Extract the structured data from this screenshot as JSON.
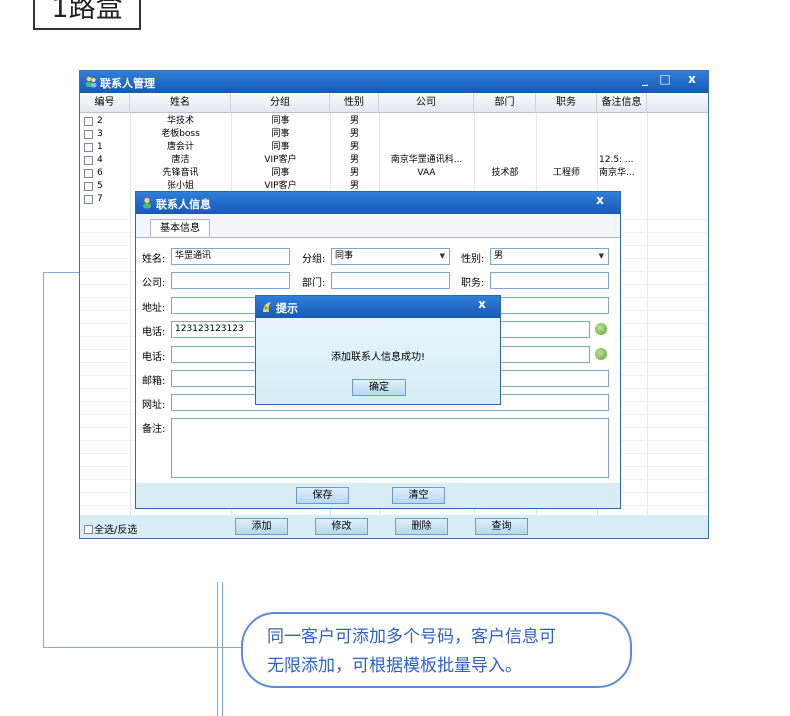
{
  "heading": {
    "text": "1路盒"
  },
  "main_window": {
    "title": "联系人管理",
    "controls": {
      "minimize": "_",
      "maximize": "□",
      "close": "x"
    },
    "columns": [
      "编号",
      "姓名",
      "分组",
      "性别",
      "公司",
      "部门",
      "职务",
      "备注信息"
    ],
    "rows": [
      {
        "id": "2",
        "name": "华技术",
        "group": "同事",
        "gender": "男",
        "company": "",
        "dept": "",
        "title": "",
        "note": ""
      },
      {
        "id": "3",
        "name": "老板boss",
        "group": "同事",
        "gender": "男",
        "company": "",
        "dept": "",
        "title": "",
        "note": ""
      },
      {
        "id": "1",
        "name": "唐会计",
        "group": "同事",
        "gender": "男",
        "company": "",
        "dept": "",
        "title": "",
        "note": ""
      },
      {
        "id": "4",
        "name": "唐洁",
        "group": "VIP客户",
        "gender": "男",
        "company": "南京华罡通讯科...",
        "dept": "",
        "title": "",
        "note": "12.5: ..."
      },
      {
        "id": "6",
        "name": "先锋音讯",
        "group": "同事",
        "gender": "男",
        "company": "VAA",
        "dept": "技术部",
        "title": "工程师",
        "note": "南京华..."
      },
      {
        "id": "5",
        "name": "张小姐",
        "group": "VIP客户",
        "gender": "男",
        "company": "",
        "dept": "",
        "title": "",
        "note": ""
      },
      {
        "id": "7",
        "name": "",
        "group": "",
        "gender": "",
        "company": "",
        "dept": "",
        "title": "",
        "note": ""
      }
    ],
    "select_all_label": "全选/反选",
    "buttons": {
      "add": "添加",
      "edit": "修改",
      "delete": "删除",
      "query": "查询"
    }
  },
  "contact_dialog": {
    "title": "联系人信息",
    "close": "x",
    "tab": "基本信息",
    "labels": {
      "name": "姓名:",
      "group": "分组:",
      "gender": "性别:",
      "company": "公司:",
      "dept": "部门:",
      "title": "职务:",
      "address": "地址:",
      "phone1": "电话:",
      "phone2": "电话:",
      "email": "邮箱:",
      "website": "网址:",
      "note": "备注:"
    },
    "values": {
      "name": "华罡通讯",
      "group": "同事",
      "gender": "男",
      "company": "",
      "dept": "",
      "title": "",
      "address": "",
      "phone1": "123123123123",
      "phone2": "",
      "email": "",
      "website": "",
      "note": ""
    },
    "buttons": {
      "save": "保存",
      "clear": "清空"
    }
  },
  "message_box": {
    "title": "提示",
    "close": "x",
    "message": "添加联系人信息成功!",
    "ok": "确定"
  },
  "annotation": {
    "line1": "同一客户可添加多个号码，客户信息可",
    "line2": "无限添加，可根据模板批量导入。"
  },
  "colors": {
    "titlebar": "#1f6fcf",
    "accent": "#2e62c8",
    "footer": "#d8eef4"
  }
}
